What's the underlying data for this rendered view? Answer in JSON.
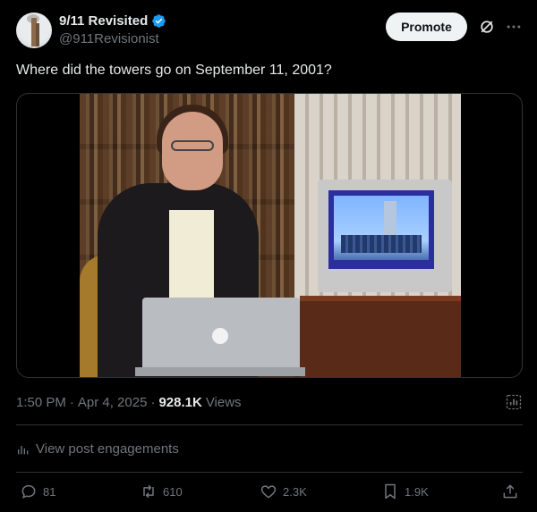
{
  "author": {
    "display_name": "9/11 Revisited",
    "handle": "@911Revisionist",
    "verified": true,
    "avatar_icon": "tower-avatar-icon"
  },
  "header": {
    "promote_label": "Promote",
    "grok_icon": "grok-icon",
    "more_icon": "more-icon"
  },
  "tweet": {
    "text": "Where did the towers go on September 11, 2001?"
  },
  "meta": {
    "time": "1:50 PM",
    "separator": "·",
    "date": "Apr 4, 2025",
    "views_count": "928.1K",
    "views_label": "Views"
  },
  "engagements": {
    "label": "View post engagements"
  },
  "actions": {
    "replies": "81",
    "reposts": "610",
    "likes": "2.3K",
    "bookmarks": "1.9K"
  },
  "colors": {
    "background": "#000000",
    "text": "#e7e9ea",
    "muted": "#71767b",
    "verified": "#1d9bf0",
    "divider": "#2f3336"
  }
}
